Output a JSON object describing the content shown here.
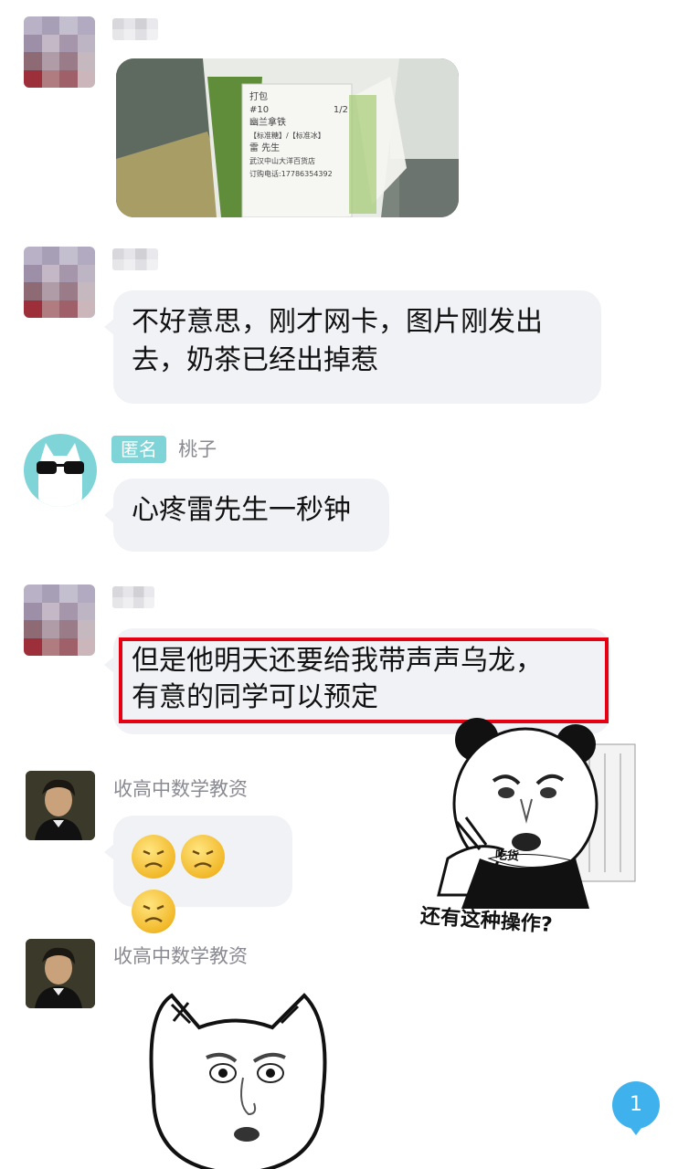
{
  "messages": [
    {
      "type": "image",
      "alt_icon": "milk-tea-cup-photo",
      "receipt_lines": [
        "打包",
        "#10",
        "1/2",
        "幽兰拿铁",
        "【标准糖】/【标准冰】",
        "雷 先生",
        "武汉中山大洋百货店",
        "订购电话:17786354392"
      ]
    },
    {
      "type": "text",
      "text_line1": "不好意思，刚才网卡，图片刚发出",
      "text_line2": "去，奶茶已经出掉惹"
    },
    {
      "type": "text",
      "tag": "匿名",
      "sender": "桃子",
      "text": "心疼雷先生一秒钟"
    },
    {
      "type": "text",
      "text_line1": "但是他明天还要给我带声声乌龙，",
      "text_line2": "有意的同学可以预定"
    },
    {
      "type": "emoji",
      "sender": "收高中数学教资",
      "emoji_icon": "sad-face-emoji"
    },
    {
      "type": "sticker",
      "sender": "收高中数学教资"
    }
  ],
  "overlay_sticker": {
    "caption": "还有这种操作?",
    "shirt_text": "吃货"
  },
  "unread_count": "1",
  "colors": {
    "bubble": "#f1f2f6",
    "highlight": "#e60012",
    "badge": "#3fb2ee",
    "tag": "#7fd4d8"
  }
}
